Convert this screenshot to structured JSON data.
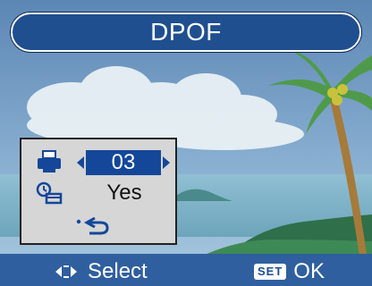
{
  "title": "DPOF",
  "menu": {
    "print_copies": "03",
    "date_imprint": "Yes"
  },
  "footer": {
    "select_label": "Select",
    "ok_label": "OK",
    "set_badge": "SET"
  },
  "icons": {
    "printer": "printer-icon",
    "date": "date-icon",
    "back": "back-icon",
    "dpad": "dpad-left-right-icon"
  },
  "colors": {
    "title_bar": "#1f4f8f",
    "highlight": "#14479a",
    "footer": "#2f5f9e",
    "panel": "#d6d6d6"
  }
}
